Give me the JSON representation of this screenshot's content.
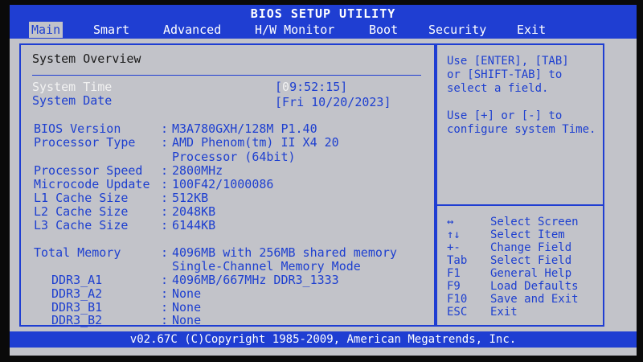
{
  "title": "BIOS SETUP UTILITY",
  "menu": [
    "Main",
    "Smart",
    "Advanced",
    "H/W Monitor",
    "Boot",
    "Security",
    "Exit"
  ],
  "main": {
    "section_title": "System Overview",
    "system_time_label": "System Time",
    "system_time_value": "[09:52:15]",
    "system_date_label": "System Date",
    "system_date_value": "[Fri 10/20/2023]",
    "bios_version_label": "BIOS Version",
    "bios_version_value": "M3A780GXH/128M P1.40",
    "processor_type_label": "Processor Type",
    "processor_type_value_1": "AMD Phenom(tm) II X4 20",
    "processor_type_value_2": "Processor (64bit)",
    "processor_speed_label": "Processor Speed",
    "processor_speed_value": "2800MHz",
    "microcode_label": "Microcode Update",
    "microcode_value": "100F42/1000086",
    "l1_label": "L1 Cache Size",
    "l1_value": "512KB",
    "l2_label": "L2 Cache Size",
    "l2_value": "2048KB",
    "l3_label": "L3 Cache Size",
    "l3_value": "6144KB",
    "total_memory_label": "Total Memory",
    "total_memory_value_1": "4096MB with 256MB shared memory",
    "total_memory_value_2": "Single-Channel Memory Mode",
    "ddr3_a1_label": "DDR3_A1",
    "ddr3_a1_value": "4096MB/667MHz  DDR3_1333",
    "ddr3_a2_label": "DDR3_A2",
    "ddr3_a2_value": "None",
    "ddr3_b1_label": "DDR3_B1",
    "ddr3_b1_value": "None",
    "ddr3_b2_label": "DDR3_B2",
    "ddr3_b2_value": "None",
    "separator": ":"
  },
  "help": {
    "line1": "Use [ENTER], [TAB]",
    "line2": "or [SHIFT-TAB] to",
    "line3": "select a field.",
    "line4": "Use [+] or [-] to",
    "line5": "configure system Time.",
    "keys": [
      {
        "key": "↔",
        "desc": "Select Screen"
      },
      {
        "key": "↑↓",
        "desc": "Select Item"
      },
      {
        "key": "+-",
        "desc": "Change Field"
      },
      {
        "key": "Tab",
        "desc": "Select Field"
      },
      {
        "key": "F1",
        "desc": "General Help"
      },
      {
        "key": "F9",
        "desc": "Load Defaults"
      },
      {
        "key": "F10",
        "desc": "Save and Exit"
      },
      {
        "key": "ESC",
        "desc": "Exit"
      }
    ]
  },
  "footer": "v02.67C (C)Copyright 1985-2009, American Megatrends, Inc.",
  "colors": {
    "background": "#c2c3c9",
    "accent_blue": "#1f3ed2",
    "text_blue": "#1d3fd0",
    "highlight_white": "#f2f2f2"
  }
}
